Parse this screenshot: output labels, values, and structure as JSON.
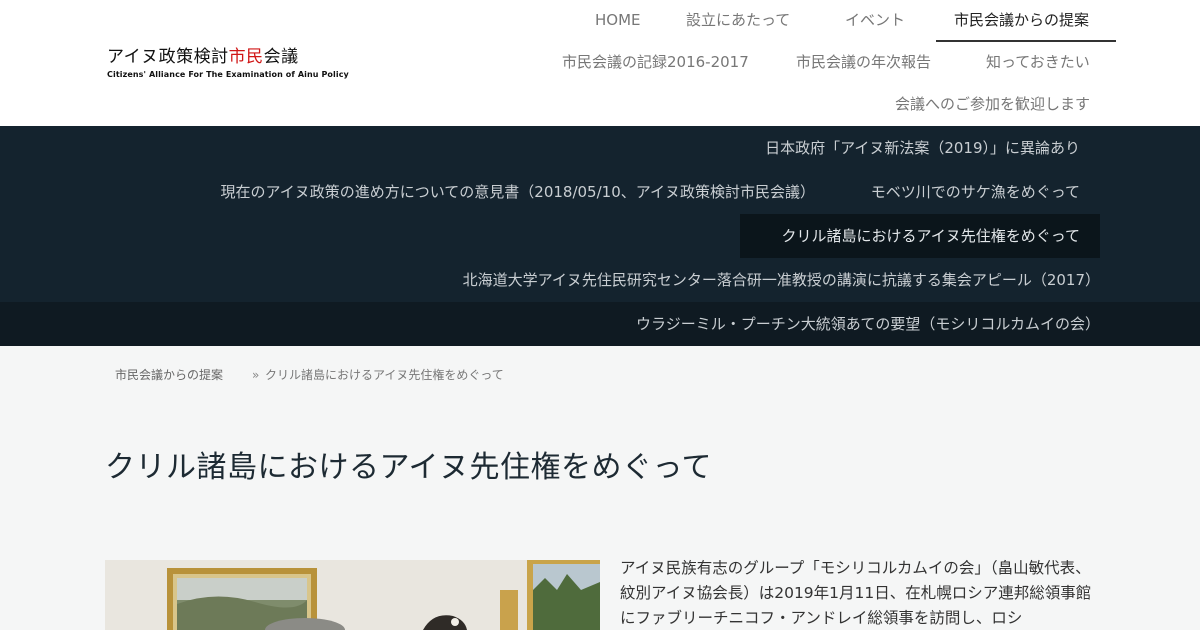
{
  "header": {
    "logo": {
      "title_a": "アイヌ政策検討",
      "title_red": "市民",
      "title_b": "会議",
      "subtitle": "Citizens' Alliance For The Examination of Ainu Policy"
    },
    "nav": [
      {
        "label": "HOME"
      },
      {
        "label": "設立にあたって"
      },
      {
        "label": "イベント"
      },
      {
        "label": "市民会議からの提案",
        "active": true
      },
      {
        "label": "市民会議の記録2016-2017"
      },
      {
        "label": "市民会議の年次報告"
      },
      {
        "label": "知っておきたい"
      },
      {
        "label": "会議へのご参加を歓迎します"
      }
    ]
  },
  "dropdown": {
    "items": [
      {
        "label": "日本政府「アイヌ新法案（2019）」に異論あり"
      },
      {
        "label": "現在のアイヌ政策の進め方についての意見書（2018/05/10、アイヌ政策検討市民会議）"
      },
      {
        "label": "モベツ川でのサケ漁をめぐって"
      },
      {
        "label": "クリル諸島におけるアイヌ先住権をめぐって",
        "active": true
      },
      {
        "label": "北海道大学アイヌ先住民研究センター落合研一准教授の講演に抗議する集会アピール（2017）"
      },
      {
        "label": "ウラジーミル・プーチン大統領あての要望（モシリコルカムイの会）"
      }
    ]
  },
  "breadcrumb": {
    "parent": "市民会議からの提案",
    "separator": "»",
    "current": "クリル諸島におけるアイヌ先住権をめぐって"
  },
  "page": {
    "title": "クリル諸島におけるアイヌ先住権をめぐって",
    "body": "アイヌ民族有志のグループ「モシリコルカムイの会」（畠山敏代表、紋別アイヌ協会長）は2019年1月11日、在札幌ロシア連邦総領事館にファブリーチニコフ・アンドレイ総領事を訪問し、ロシ"
  },
  "colors": {
    "dropdown_bg": "#14232e",
    "dropdown_active_bg": "#0b151b",
    "logo_accent": "#d01616",
    "page_bg": "#f5f6f6"
  }
}
